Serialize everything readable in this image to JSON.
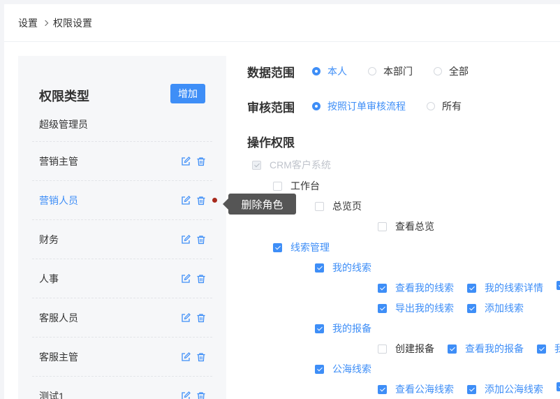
{
  "breadcrumb": {
    "root": "设置",
    "current": "权限设置"
  },
  "left": {
    "title": "权限类型",
    "add_label": "增加",
    "roles": [
      {
        "label": "超级管理员",
        "actions": false
      },
      {
        "label": "营销主管",
        "actions": true
      },
      {
        "label": "营销人员",
        "actions": true,
        "active": true
      },
      {
        "label": "财务",
        "actions": true
      },
      {
        "label": "人事",
        "actions": true
      },
      {
        "label": "客服人员",
        "actions": true
      },
      {
        "label": "客服主管",
        "actions": true
      },
      {
        "label": "测试1",
        "actions": true
      }
    ],
    "tooltip": "删除角色"
  },
  "data_scope": {
    "label": "数据范围",
    "options": [
      {
        "label": "本人",
        "checked": true
      },
      {
        "label": "本部门",
        "checked": false
      },
      {
        "label": "全部",
        "checked": false
      }
    ]
  },
  "review_scope": {
    "label": "审核范围",
    "options": [
      {
        "label": "按照订单审核流程",
        "checked": true
      },
      {
        "label": "所有",
        "checked": false
      }
    ]
  },
  "ops": {
    "label": "操作权限",
    "items": [
      {
        "label": "CRM客户系统",
        "state": "disabled"
      },
      {
        "label": "工作台",
        "state": "unchecked"
      },
      {
        "label": "总览页",
        "state": "unchecked"
      },
      {
        "label": "查看总览",
        "state": "unchecked"
      },
      {
        "label": "线索管理",
        "state": "checked"
      },
      {
        "label": "我的线索",
        "state": "checked"
      },
      {
        "label": "查看我的线索",
        "state": "checked"
      },
      {
        "label": "我的线索详情",
        "state": "checked"
      },
      {
        "label": "",
        "state": "checked"
      },
      {
        "label": "导出我的线索",
        "state": "checked"
      },
      {
        "label": "添加线索",
        "state": "checked"
      },
      {
        "label": "我的报备",
        "state": "checked"
      },
      {
        "label": "创建报备",
        "state": "unchecked"
      },
      {
        "label": "查看我的报备",
        "state": "checked"
      },
      {
        "label": "我的",
        "state": "checked"
      },
      {
        "label": "公海线索",
        "state": "checked"
      },
      {
        "label": "查看公海线索",
        "state": "checked"
      },
      {
        "label": "添加公海线索",
        "state": "checked"
      },
      {
        "label": "",
        "state": "checked"
      }
    ]
  }
}
